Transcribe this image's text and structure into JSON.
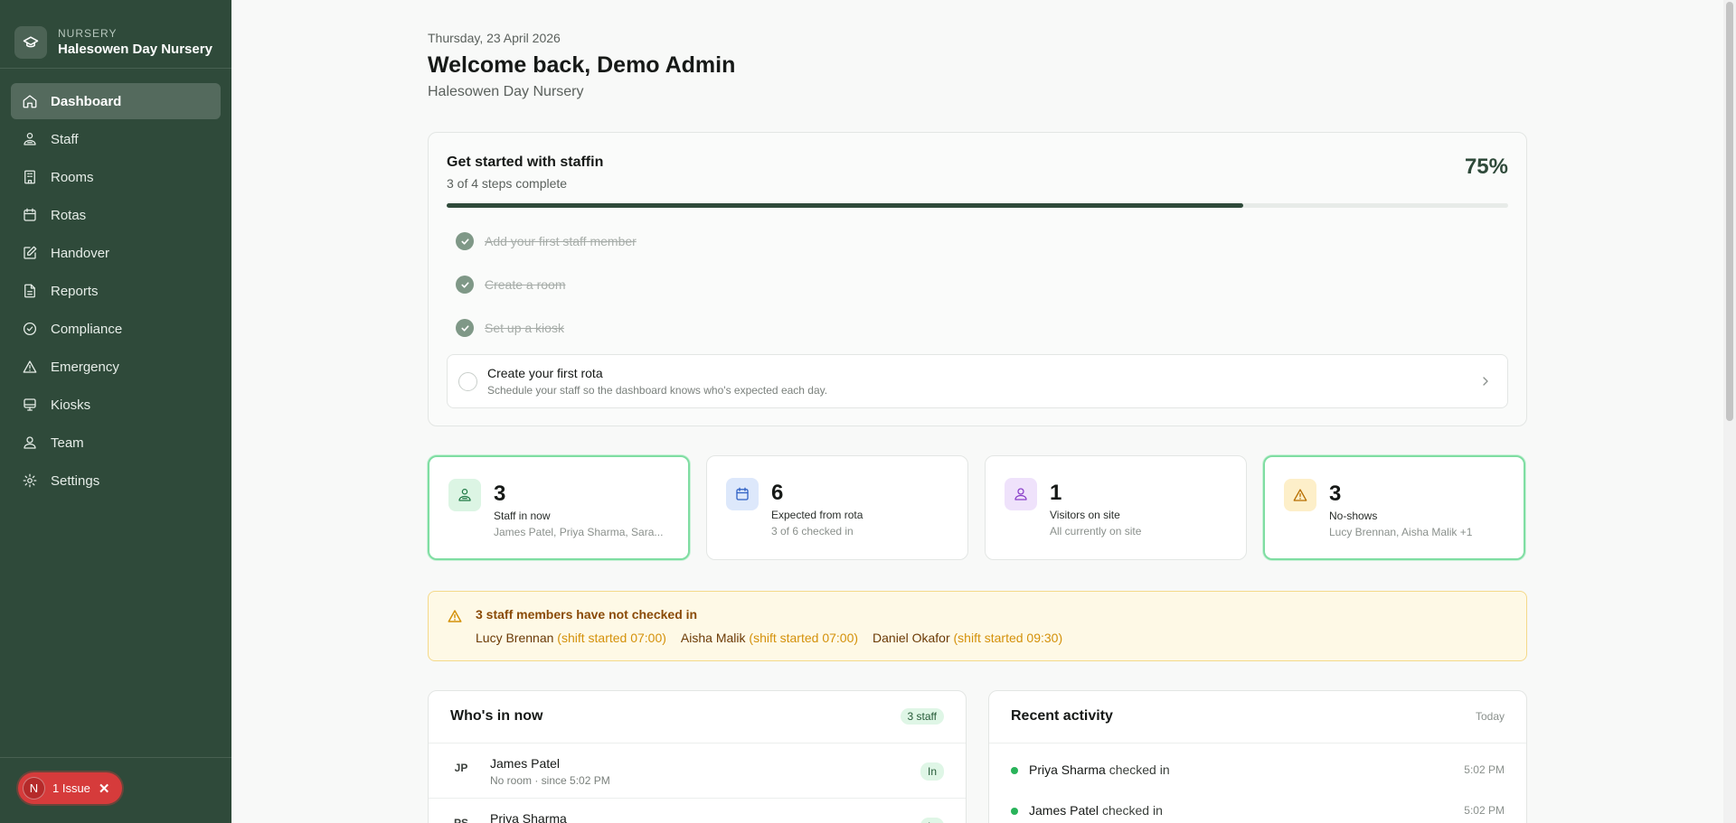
{
  "brand": {
    "label": "NURSERY",
    "name": "Halesowen Day Nursery"
  },
  "nav": [
    {
      "label": "Dashboard",
      "icon": "home-icon",
      "active": true
    },
    {
      "label": "Staff",
      "icon": "staff-icon"
    },
    {
      "label": "Rooms",
      "icon": "building-icon"
    },
    {
      "label": "Rotas",
      "icon": "calendar-icon"
    },
    {
      "label": "Handover",
      "icon": "edit-icon"
    },
    {
      "label": "Reports",
      "icon": "document-icon"
    },
    {
      "label": "Compliance",
      "icon": "check-circle-icon"
    },
    {
      "label": "Emergency",
      "icon": "warning-icon"
    },
    {
      "label": "Kiosks",
      "icon": "monitor-icon"
    },
    {
      "label": "Team",
      "icon": "team-icon"
    },
    {
      "label": "Settings",
      "icon": "gear-icon"
    }
  ],
  "issue": {
    "avatar": "N",
    "label": "1 Issue",
    "close": "✕"
  },
  "header": {
    "date": "Thursday, 23 April 2026",
    "welcome": "Welcome back, Demo Admin",
    "subtitle": "Halesowen Day Nursery"
  },
  "getstarted": {
    "title": "Get started with staffin",
    "progress_text": "3 of 4 steps complete",
    "percent_label": "75%",
    "progress": 0.75,
    "done_steps": [
      "Add your first staff member",
      "Create a room",
      "Set up a kiosk"
    ],
    "next_step": {
      "title": "Create your first rota",
      "desc": "Schedule your staff so the dashboard knows who's expected each day."
    }
  },
  "stats": [
    {
      "num": "3",
      "label": "Staff in now",
      "detail": "James Patel, Priya Sharma, Sara...",
      "icon": "staff-icon",
      "bg": "#dcf5e4",
      "color": "#1f7a45",
      "highlight": true
    },
    {
      "num": "6",
      "label": "Expected from rota",
      "detail": "3 of 6 checked in",
      "icon": "calendar-icon",
      "bg": "#dde8fb",
      "color": "#2d5fc4",
      "highlight": false
    },
    {
      "num": "1",
      "label": "Visitors on site",
      "detail": "All currently on site",
      "icon": "user-icon",
      "bg": "#efe2fb",
      "color": "#8a3fc9",
      "highlight": false
    },
    {
      "num": "3",
      "label": "No-shows",
      "detail": "Lucy Brennan, Aisha Malik +1",
      "icon": "warning-icon",
      "bg": "#fdefc9",
      "color": "#b76e00",
      "highlight": true
    }
  ],
  "alert": {
    "title": "3 staff members have not checked in",
    "items": [
      {
        "name": "Lucy Brennan",
        "shift": "(shift started 07:00)"
      },
      {
        "name": "Aisha Malik",
        "shift": "(shift started 07:00)"
      },
      {
        "name": "Daniel Okafor",
        "shift": "(shift started 09:30)"
      }
    ]
  },
  "whos_in": {
    "title": "Who's in now",
    "badge": "3 staff",
    "rows": [
      {
        "initials": "JP",
        "name": "James Patel",
        "sub": "No room · since 5:02 PM",
        "status": "In"
      },
      {
        "initials": "PS",
        "name": "Priya Sharma",
        "sub": "",
        "status": "In"
      }
    ]
  },
  "activity": {
    "title": "Recent activity",
    "meta": "Today",
    "items": [
      {
        "name": "Priya Sharma",
        "action": "checked in",
        "time": "5:02 PM"
      },
      {
        "name": "James Patel",
        "action": "checked in",
        "time": "5:02 PM"
      }
    ]
  }
}
